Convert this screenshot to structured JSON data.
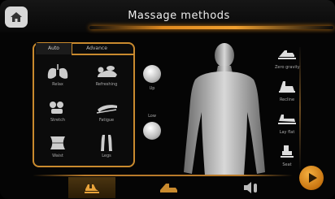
{
  "title": "Massage methods",
  "tabs": [
    {
      "label": "Auto",
      "active": true
    },
    {
      "label": "Advance",
      "active": false
    }
  ],
  "massage_programs": [
    {
      "label": "Relax",
      "icon": "lungs-icon"
    },
    {
      "label": "Refreshing",
      "icon": "sleeping-person-icon"
    },
    {
      "label": "Stretch",
      "icon": "stretch-icon"
    },
    {
      "label": "Fatigue",
      "icon": "reclining-icon"
    },
    {
      "label": "Waist",
      "icon": "waist-icon"
    },
    {
      "label": "Legs",
      "icon": "legs-icon"
    }
  ],
  "balls": [
    {
      "label": "Up"
    },
    {
      "label": "Low"
    }
  ],
  "positions": [
    {
      "label": "Zero gravity",
      "icon": "zero-gravity-icon"
    },
    {
      "label": "Recline",
      "icon": "recline-icon"
    },
    {
      "label": "Lay flat",
      "icon": "lay-flat-icon"
    },
    {
      "label": "Seat",
      "icon": "seat-icon"
    }
  ],
  "bottom_tabs": [
    {
      "name": "massage-methods-tab",
      "icon": "massage-hands-icon",
      "active": true
    },
    {
      "name": "chair-tab",
      "icon": "chair-icon",
      "active": false
    },
    {
      "name": "audio-tab",
      "icon": "audio-icon",
      "active": false
    }
  ],
  "colors": {
    "accent": "#c98a2e",
    "background": "#050505",
    "play": "#e8962a"
  }
}
